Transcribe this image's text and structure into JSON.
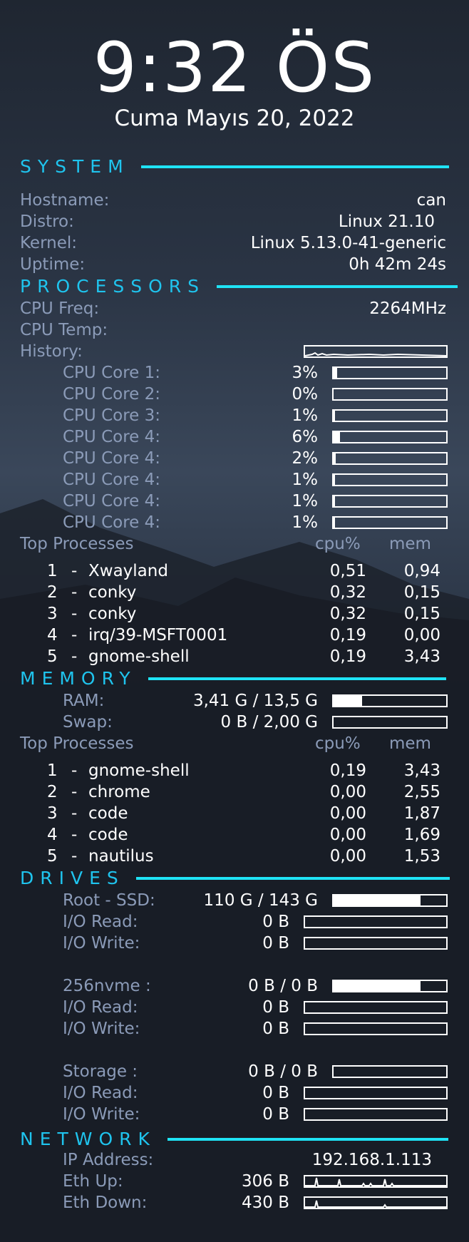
{
  "clock": {
    "time": "9:32 ÖS",
    "date": "Cuma Mayıs 20, 2022"
  },
  "system": {
    "title": "SYSTEM",
    "rows": [
      {
        "label": "Hostname:",
        "value": "can"
      },
      {
        "label": "Distro:",
        "value": "Linux 21.10"
      },
      {
        "label": "Kernel:",
        "value": "Linux 5.13.0-41-generic"
      },
      {
        "label": "Uptime:",
        "value": "0h 42m 24s"
      }
    ]
  },
  "processors": {
    "title": "PROCESSORS",
    "freq_label": "CPU Freq:",
    "freq_value": "2264MHz",
    "temp_label": "CPU Temp:",
    "history_label": "History:",
    "cores": [
      {
        "label": "CPU Core 1:",
        "value": "3%",
        "pct": 3
      },
      {
        "label": "CPU Core 2:",
        "value": "0%",
        "pct": 0
      },
      {
        "label": "CPU Core 3:",
        "value": "1%",
        "pct": 1
      },
      {
        "label": "CPU Core 4:",
        "value": "6%",
        "pct": 6
      },
      {
        "label": "CPU Core 4:",
        "value": "2%",
        "pct": 2
      },
      {
        "label": "CPU Core 4:",
        "value": "1%",
        "pct": 1
      },
      {
        "label": "CPU Core 4:",
        "value": "1%",
        "pct": 1
      },
      {
        "label": "CPU Core 4:",
        "value": "1%",
        "pct": 1
      }
    ],
    "top_header": {
      "label": "Top Processes",
      "cpu": "cpu%",
      "mem": "mem"
    },
    "top": [
      {
        "rank": "1",
        "name": "Xwayland",
        "cpu": "0,51",
        "mem": "0,94"
      },
      {
        "rank": "2",
        "name": "conky",
        "cpu": "0,32",
        "mem": "0,15"
      },
      {
        "rank": "3",
        "name": "conky",
        "cpu": "0,32",
        "mem": "0,15"
      },
      {
        "rank": "4",
        "name": "irq/39-MSFT0001",
        "cpu": "0,19",
        "mem": "0,00"
      },
      {
        "rank": "5",
        "name": "gnome-shell",
        "cpu": "0,19",
        "mem": "3,43"
      }
    ]
  },
  "memory": {
    "title": "MEMORY",
    "ram_label": "RAM:",
    "ram_value": "3,41 G / 13,5 G",
    "ram_pct": 25,
    "swap_label": "Swap:",
    "swap_value": "0 B / 2,00 G",
    "swap_pct": 0,
    "top_header": {
      "label": "Top Processes",
      "cpu": "cpu%",
      "mem": "mem"
    },
    "top": [
      {
        "rank": "1",
        "name": "gnome-shell",
        "cpu": "0,19",
        "mem": "3,43"
      },
      {
        "rank": "2",
        "name": "chrome",
        "cpu": "0,00",
        "mem": "2,55"
      },
      {
        "rank": "3",
        "name": "code",
        "cpu": "0,00",
        "mem": "1,87"
      },
      {
        "rank": "4",
        "name": "code",
        "cpu": "0,00",
        "mem": "1,69"
      },
      {
        "rank": "5",
        "name": "nautilus",
        "cpu": "0,00",
        "mem": "1,53"
      }
    ]
  },
  "drives": {
    "title": "DRIVES",
    "list": [
      {
        "label": "Root  -  SSD:",
        "value": "110 G / 143 G",
        "pct": 77,
        "read_label": "I/O Read:",
        "read": "0 B",
        "write_label": "I/O Write:",
        "write": "0 B"
      },
      {
        "label": "256nvme :",
        "value": "0 B / 0 B",
        "pct": 77,
        "read_label": "I/O Read:",
        "read": "0 B",
        "write_label": "I/O Write:",
        "write": "0 B"
      },
      {
        "label": "Storage :",
        "value": "0 B / 0 B",
        "pct": 0,
        "read_label": "I/O Read:",
        "read": "0 B",
        "write_label": "I/O Write:",
        "write": "0 B"
      }
    ]
  },
  "network": {
    "title": "NETWORK",
    "ip_label": "IP Address:",
    "ip_value": "192.168.1.113",
    "up_label": "Eth Up:",
    "up_value": "306 B",
    "down_label": "Eth Down:",
    "down_value": "430 B"
  },
  "colors": {
    "accent": "#1fc4ee",
    "label": "#8b9bb8",
    "text": "#ffffff"
  }
}
